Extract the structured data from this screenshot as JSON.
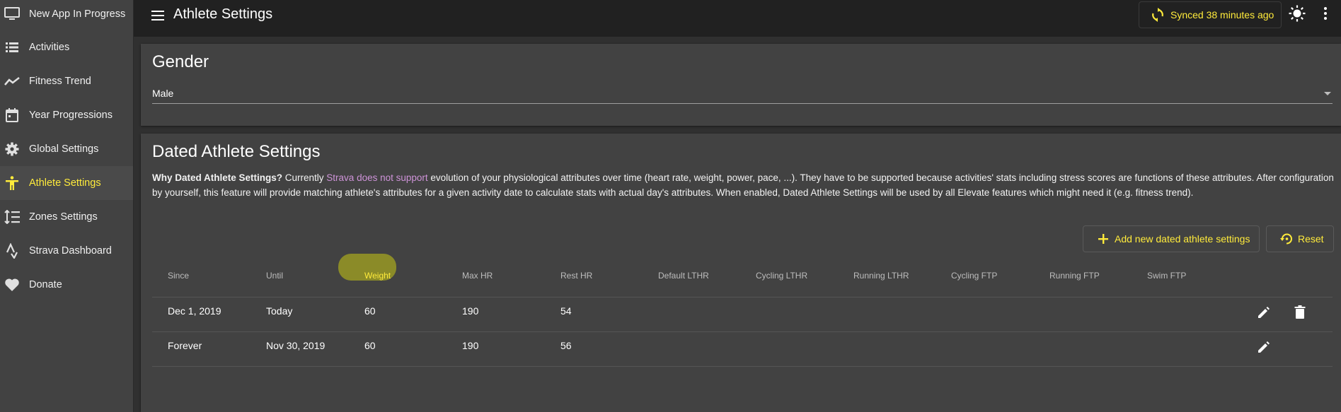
{
  "app": {
    "page_title": "Athlete Settings",
    "accent": "#ffeb3b",
    "link_color": "#ce93d8"
  },
  "sidebar": {
    "items": [
      {
        "label": "New App In Progress",
        "icon": "monitor-icon"
      },
      {
        "label": "Activities",
        "icon": "list-icon"
      },
      {
        "label": "Fitness Trend",
        "icon": "trend-icon"
      },
      {
        "label": "Year Progressions",
        "icon": "calendar-icon"
      },
      {
        "label": "Global Settings",
        "icon": "gear-icon"
      },
      {
        "label": "Athlete Settings",
        "icon": "person-icon",
        "active": true
      },
      {
        "label": "Zones Settings",
        "icon": "zones-icon"
      },
      {
        "label": "Strava Dashboard",
        "icon": "strava-icon"
      },
      {
        "label": "Donate",
        "icon": "heart-icon"
      }
    ]
  },
  "topbar": {
    "sync_label": "Synced 38 minutes ago",
    "theme_icon": "sun-icon",
    "more_icon": "more-vert-icon"
  },
  "gender": {
    "title": "Gender",
    "value": "Male"
  },
  "dated": {
    "title": "Dated Athlete Settings",
    "desc_bold": "Why Dated Athlete Settings?",
    "desc_pre": " Currently ",
    "desc_link": "Strava does not support",
    "desc_post": " evolution of your physiological attributes over time (heart rate, weight, power, pace, ...). They have to be supported because activities' stats including stress scores are functions of these attributes. After configuration by yourself, this feature will provide matching athlete's attributes for a given activity date to calculate stats with actual day's attributes. When enabled, Dated Athlete Settings will be used by all Elevate features which might need it (e.g. fitness trend).",
    "add_label": "Add new dated athlete settings",
    "reset_label": "Reset",
    "columns": [
      "Since",
      "Until",
      "Weight",
      "Max HR",
      "Rest HR",
      "Default LTHR",
      "Cycling LTHR",
      "Running LTHR",
      "Cycling FTP",
      "Running FTP",
      "Swim FTP"
    ],
    "rows": [
      {
        "since": "Dec 1, 2019",
        "until": "Today",
        "weight": "60",
        "max_hr": "190",
        "rest_hr": "54"
      },
      {
        "since": "Forever",
        "until": "Nov 30, 2019",
        "weight": "60",
        "max_hr": "190",
        "rest_hr": "56"
      }
    ]
  }
}
